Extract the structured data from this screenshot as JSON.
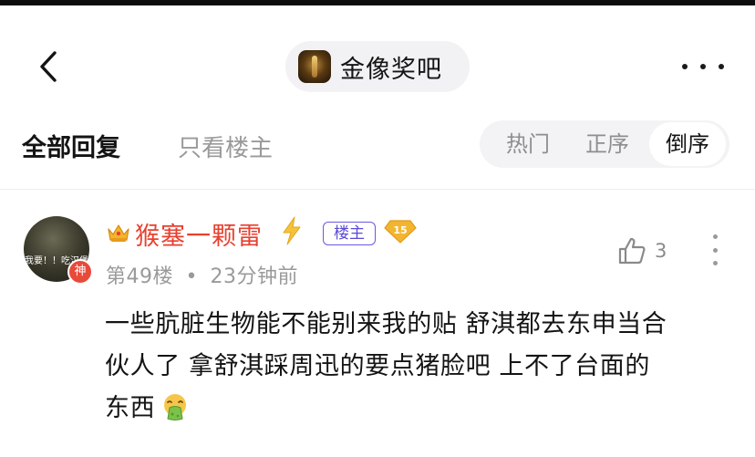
{
  "header": {
    "forum_name": "金像奖吧",
    "back_icon": "chevron-left-icon",
    "more_icon": "more-horizontal-icon"
  },
  "filter": {
    "tab_all": "全部回复",
    "tab_op_only": "只看楼主",
    "sort": {
      "options": [
        "热门",
        "正序",
        "倒序"
      ],
      "selected": "倒序"
    }
  },
  "post": {
    "avatar_text": "我要！！吃汉堡",
    "avatar_badge": "神",
    "username": "猴塞一颗雷",
    "op_tag": "楼主",
    "level": "15",
    "floor": "第49楼",
    "separator": "•",
    "time": "23分钟前",
    "likes": "3",
    "content_lines": [
      "一些肮脏生物能不能别来我的贴 舒淇都去东申当合",
      "伙人了 拿舒淇踩周迅的要点猪脸吧 上不了台面的",
      "东西"
    ],
    "emoji_icon": "vomit-face-emoji"
  },
  "colors": {
    "username": "#e8402f",
    "op_tag": "#5a4ad6",
    "level_badge": "#f2b531",
    "muted": "#9a9a9a"
  }
}
